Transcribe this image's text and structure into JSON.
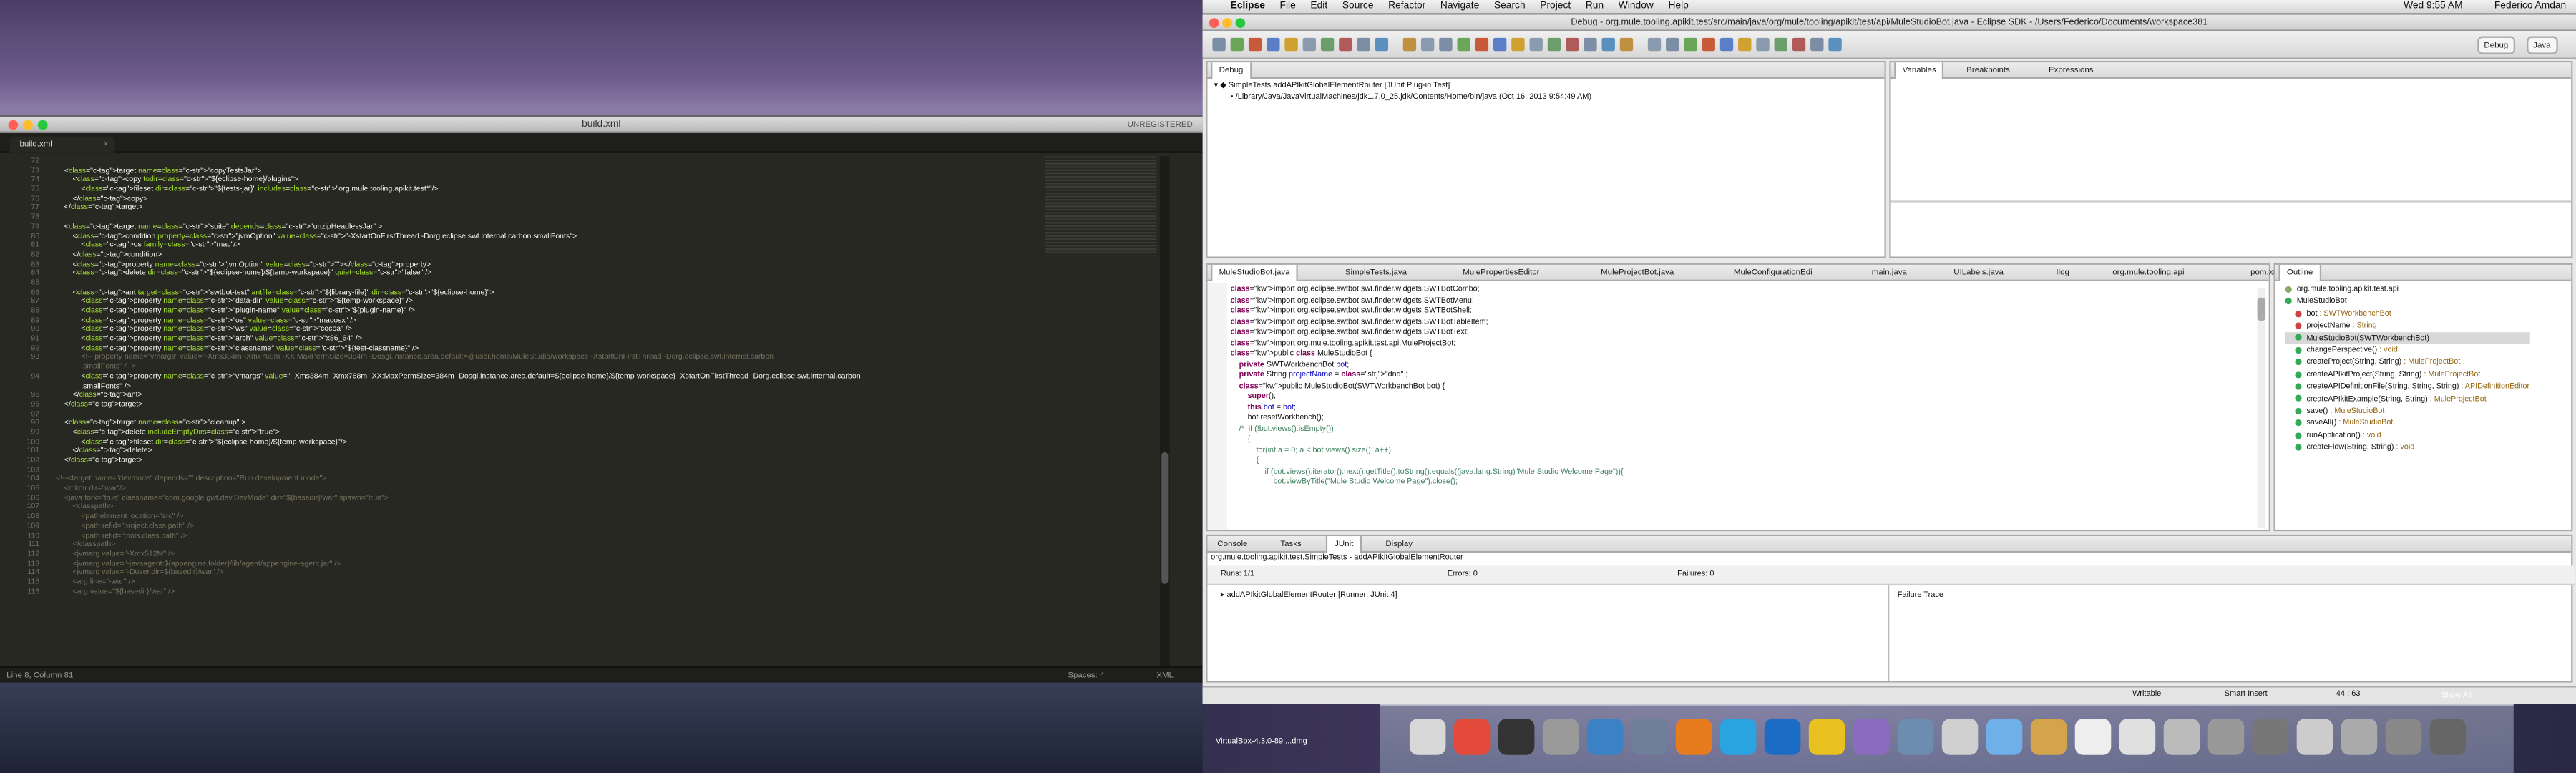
{
  "menubar": {
    "apple": "",
    "items": [
      "Eclipse",
      "File",
      "Edit",
      "Source",
      "Refactor",
      "Navigate",
      "Search",
      "Project",
      "Run",
      "Window",
      "Help"
    ],
    "clock": "Wed 9:55 AM",
    "user": "Federico Amdan"
  },
  "sublime": {
    "title": "build.xml",
    "unregistered": "UNREGISTERED",
    "tab": "build.xml",
    "status": {
      "position": "Line 8, Column 81",
      "spaces": "Spaces: 4",
      "syntax": "XML"
    },
    "lines": [
      {
        "n": "72",
        "t": ""
      },
      {
        "n": "73",
        "t": "    <target name=\"copyTestsJar\">"
      },
      {
        "n": "74",
        "t": "        <copy todir=\"${eclipse-home}/plugins\">"
      },
      {
        "n": "75",
        "t": "            <fileset dir=\"${tests-jar}\" includes=\"org.mule.tooling.apikit.test*\"/>"
      },
      {
        "n": "76",
        "t": "        </copy>"
      },
      {
        "n": "77",
        "t": "    </target>"
      },
      {
        "n": "78",
        "t": ""
      },
      {
        "n": "79",
        "t": "    <target name=\"suite\" depends=\"unzipHeadlessJar\" >"
      },
      {
        "n": "80",
        "t": "        <condition property=\"jvmOption\" value=\"-XstartOnFirstThread -Dorg.eclipse.swt.internal.carbon.smallFonts\">"
      },
      {
        "n": "81",
        "t": "            <os family=\"mac\"/>"
      },
      {
        "n": "82",
        "t": "        </condition>"
      },
      {
        "n": "83",
        "t": "        <property name=\"jvmOption\" value=\"\"></property>"
      },
      {
        "n": "84",
        "t": "        <delete dir=\"${eclipse-home}/${temp-workspace}\" quiet=\"false\" />"
      },
      {
        "n": "85",
        "t": ""
      },
      {
        "n": "86",
        "t": "        <ant target=\"swtbot-test\" antfile=\"${library-file}\" dir=\"${eclipse-home}\">"
      },
      {
        "n": "87",
        "t": "            <property name=\"data-dir\" value=\"${temp-workspace}\" />"
      },
      {
        "n": "88",
        "t": "            <property name=\"plugin-name\" value=\"${plugin-name}\" />"
      },
      {
        "n": "89",
        "t": "            <property name=\"os\" value=\"macosx\" />"
      },
      {
        "n": "90",
        "t": "            <property name=\"ws\" value=\"cocoa\" />"
      },
      {
        "n": "91",
        "t": "            <property name=\"arch\" value=\"x86_64\" />"
      },
      {
        "n": "92",
        "t": "            <property name=\"classname\" value=\"${test-classname}\" />"
      },
      {
        "n": "93",
        "t": "            <!-- property name=\"vmargs\" value=\"-Xms384m -Xmx768m -XX:MaxPermSize=384m -Dosgi.instance.area.default=@user.home/MuleStudio/workspace -XstartOnFirstThread -Dorg.eclipse.swt.internal.carbon"
      },
      {
        "n": "",
        "t": "            .smallFonts\" /-->"
      },
      {
        "n": "94",
        "t": "            <property name=\"vmargs\" value=\" -Xms384m -Xmx768m -XX:MaxPermSize=384m -Dosgi.instance.area.default=${eclipse-home}/${temp-workspace} -XstartOnFirstThread -Dorg.eclipse.swt.internal.carbon"
      },
      {
        "n": "",
        "t": "            .smallFonts\" />"
      },
      {
        "n": "95",
        "t": "        </ant>"
      },
      {
        "n": "96",
        "t": "    </target>"
      },
      {
        "n": "97",
        "t": ""
      },
      {
        "n": "98",
        "t": "    <target name=\"cleanup\" >"
      },
      {
        "n": "99",
        "t": "        <delete includeEmptyDirs=\"true\">"
      },
      {
        "n": "100",
        "t": "            <fileset dir=\"${eclipse-home}/${temp-workspace}\"/>"
      },
      {
        "n": "101",
        "t": "        </delete>"
      },
      {
        "n": "102",
        "t": "    </target>"
      },
      {
        "n": "103",
        "t": ""
      },
      {
        "n": "104",
        "t": "<!--<target name=\"devmode\" depends=\"\" description=\"Run development mode\">"
      },
      {
        "n": "105",
        "t": "    <mkdir dir=\"war\"/>"
      },
      {
        "n": "106",
        "t": "    <java fork=\"true\" classname=\"com.google.gwt.dev.DevMode\" dir=\"${basedir}/war\" spawn=\"true\">"
      },
      {
        "n": "107",
        "t": "        <classpath>"
      },
      {
        "n": "108",
        "t": "            <pathelement location=\"src\" />"
      },
      {
        "n": "109",
        "t": "            <path refid=\"project.class.path\" />"
      },
      {
        "n": "110",
        "t": "            <path refid=\"tools.class.path\" />"
      },
      {
        "n": "111",
        "t": "        </classpath>"
      },
      {
        "n": "112",
        "t": "        <jvmarg value=\"-Xmx512M\" />"
      },
      {
        "n": "113",
        "t": "        <jvmarg value=\"-javaagent:${appengine.folder}/lib/agent/appengine-agent.jar\" />"
      },
      {
        "n": "114",
        "t": "        <jvmarg value=\"-Duser.dir=${basedir}/war\" />"
      },
      {
        "n": "115",
        "t": "        <arg line=\"-war\" />"
      },
      {
        "n": "116",
        "t": "        <arg value=\"${basedir}/war\" />"
      }
    ]
  },
  "eclipse": {
    "title": "Debug - org.mule.tooling.apikit.test/src/main/java/org/mule/tooling/apikit/test/api/MuleStudioBot.java - Eclipse SDK - /Users/Federico/Documents/workspace381",
    "perspectives": [
      "Debug",
      "Java"
    ],
    "debug_view": {
      "tab": "Debug",
      "items": [
        "SimpleTests.addAPIkitGlobalElementRouter [JUnit Plug-in Test]",
        "/Library/Java/JavaVirtualMachines/jdk1.7.0_25.jdk/Contents/Home/bin/java (Oct 16, 2013 9:54:49 AM)"
      ]
    },
    "vars_view": {
      "tabs": [
        "Variables",
        "Breakpoints",
        "Expressions"
      ]
    },
    "editor_tabs": [
      "MuleStudioBot.java",
      "SimpleTests.java",
      "MulePropertiesEditor",
      "MuleProjectBot.java",
      "MuleConfigurationEdi",
      "main.java",
      "UILabels.java",
      "Ilog",
      "org.mule.tooling.api",
      "pom.xml",
      "»11"
    ],
    "code": [
      "import org.eclipse.swtbot.swt.finder.widgets.SWTBotCombo;",
      "import org.eclipse.swtbot.swt.finder.widgets.SWTBotMenu;",
      "import org.eclipse.swtbot.swt.finder.widgets.SWTBotShell;",
      "import org.eclipse.swtbot.swt.finder.widgets.SWTBotTableItem;",
      "import org.eclipse.swtbot.swt.finder.widgets.SWTBotText;",
      "import org.mule.tooling.apikit.test.api.MuleProjectBot;",
      "",
      "public class MuleStudioBot {",
      "",
      "    private SWTWorkbenchBot bot;",
      "    private String projectName = \"dnd\" ;",
      "    public MuleStudioBot(SWTWorkbenchBot bot) {",
      "        super();",
      "        this.bot = bot;",
      "",
      "        bot.resetWorkbench();",
      "    /*  if (!bot.views().isEmpty())",
      "        {",
      "            for(int a = 0; a < bot.views().size(); a++)",
      "            {",
      "                if (bot.views().iterator().next().getTitle().toString().equals((java.lang.String)\"Mule Studio Welcome Page\")){",
      "                    bot.viewByTitle(\"Mule Studio Welcome Page\").close();"
    ],
    "outline": {
      "tab": "Outline",
      "items": [
        {
          "label": "org.mule.tooling.apikit.test.api",
          "type": ""
        },
        {
          "label": "MuleStudioBot",
          "type": ""
        },
        {
          "label": "bot",
          "type": " : SWTWorkbenchBot"
        },
        {
          "label": "projectName",
          "type": " : String"
        },
        {
          "label": "MuleStudioBot(SWTWorkbenchBot)",
          "type": ""
        },
        {
          "label": "changePerspective()",
          "type": " : void"
        },
        {
          "label": "createProject(String, String)",
          "type": " : MuleProjectBot"
        },
        {
          "label": "createAPIkitProject(String, String)",
          "type": " : MuleProjectBot"
        },
        {
          "label": "createAPIDefinitionFile(String, String, String)",
          "type": " : APIDefinitionEditor"
        },
        {
          "label": "createAPIkitExample(String, String)",
          "type": " : MuleProjectBot"
        },
        {
          "label": "save()",
          "type": " : MuleStudioBot"
        },
        {
          "label": "saveAll()",
          "type": " : MuleStudioBot"
        },
        {
          "label": "runApplication()",
          "type": " : void"
        },
        {
          "label": "createFlow(String, String)",
          "type": " : void"
        }
      ]
    },
    "bottom_tabs": [
      "Console",
      "Tasks",
      "JUnit",
      "Display"
    ],
    "junit": {
      "path": "org.mule.tooling.apikit.test.SimpleTests - addAPIkitGlobalElementRouter",
      "runs": "Runs:  1/1",
      "errors": "Errors:  0",
      "failures": "Failures:  0",
      "test": "addAPIkitGlobalElementRouter [Runner: JUnit 4]",
      "trace": "Failure Trace"
    },
    "status": {
      "writable": "Writable",
      "insert": "Smart Insert",
      "pos": "44 : 63"
    }
  },
  "dock": {
    "virtualbox": "VirtualBox-4.3.0-89....dmg",
    "show_all": "Show All"
  }
}
